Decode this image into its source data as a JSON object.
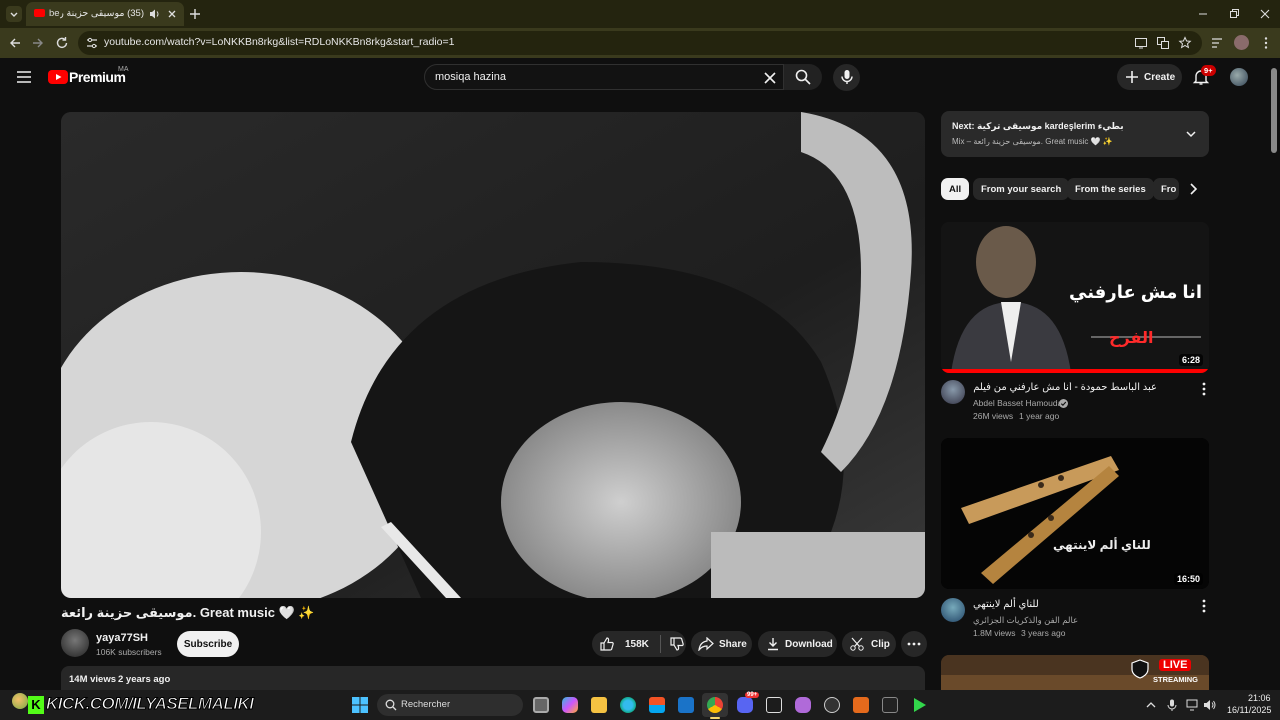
{
  "browser": {
    "tab_title": "(35) موسيقى حزينة رائعة",
    "tab_prefix": "be",
    "url": "youtube.com/watch?v=LoNKKBn8rkg&list=RDLoNKKBn8rkg&start_radio=1"
  },
  "header": {
    "logo_text": "Premium",
    "region": "MA",
    "search_value": "mosiqa hazina",
    "create_label": "Create",
    "notif_count": "9+"
  },
  "video": {
    "title": "موسيقى حزينة رائعة. Great music 🤍 ✨",
    "channel": "yaya77SH",
    "subscribers": "106K subscribers",
    "subscribe_label": "Subscribe",
    "likes": "158K",
    "share_label": "Share",
    "download_label": "Download",
    "clip_label": "Clip",
    "views": "14M views",
    "age": "2 years ago"
  },
  "next": {
    "prefix": "Next:",
    "title": "موسيقى تركية kardeşlerim بطيء",
    "subtitle": "Mix – موسيقى حزينة رائعة. Great music 🤍 ✨"
  },
  "chips": [
    {
      "label": "All"
    },
    {
      "label": "From your search"
    },
    {
      "label": "From the series"
    },
    {
      "label": "Fro"
    }
  ],
  "recommendations": [
    {
      "title": "عبد الباسط حمودة - أنا مش عارفني من فيلم ( الفرح )",
      "channel": "Abdel Basset Hamouda",
      "views": "26M views",
      "age": "1 year ago",
      "duration": "6:28",
      "thumb_text": "انا مش عارفني",
      "thumb_sub": "الفرح"
    },
    {
      "title": "للناي ألم لاينتهي",
      "channel": "عالم الفن والذكريات الجزائري",
      "views": "1.8M views",
      "age": "3 years ago",
      "duration": "16:50",
      "thumb_text": "للناي ألم لاينتهي"
    },
    {
      "live_label": "LIVE",
      "streaming_label": "STREAMING"
    }
  ],
  "taskbar": {
    "kick_text": "KICK.COM/ILYASELMALIKI",
    "search_placeholder": "Rechercher",
    "time": "21:06",
    "date": "16/11/2025",
    "badge": "99+"
  },
  "colors": {
    "accent_red": "#ff0000",
    "browser_chrome": "#3a3a1d",
    "background": "#0f0f0f"
  }
}
